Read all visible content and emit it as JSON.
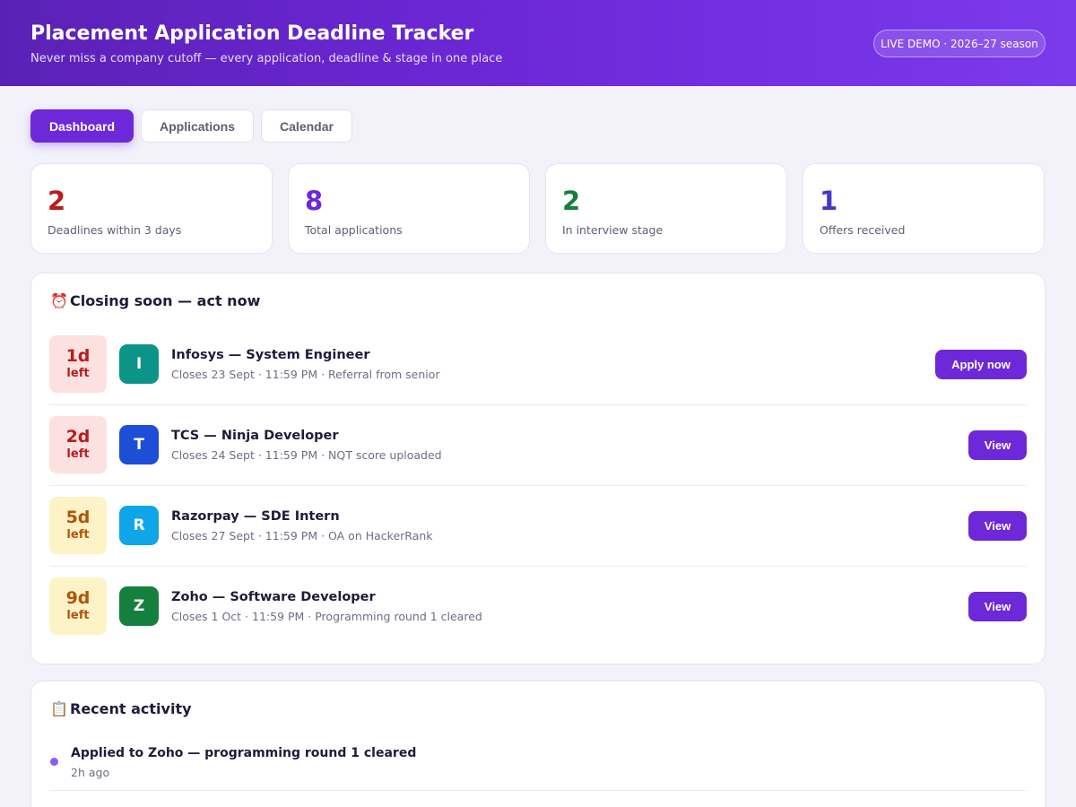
{
  "header": {
    "title": "Placement Application Deadline Tracker",
    "subtitle": "Never miss a company cutoff — every application, deadline & stage in one place",
    "badge": "LIVE DEMO · 2026–27 season"
  },
  "tabs": [
    {
      "label": "Dashboard",
      "active": true
    },
    {
      "label": "Applications",
      "active": false
    },
    {
      "label": "Calendar",
      "active": false
    }
  ],
  "stats": [
    {
      "value": "2",
      "label": "Deadlines within 3 days",
      "color": "#b91c1c"
    },
    {
      "value": "8",
      "label": "Total applications",
      "color": "#6d28d9"
    },
    {
      "value": "2",
      "label": "In interview stage",
      "color": "#15803d"
    },
    {
      "value": "1",
      "label": "Offers received",
      "color": "#4338ca"
    }
  ],
  "closing": {
    "icon": "alarm-clock-icon",
    "emoji": "⏰",
    "title": "Closing soon — act now",
    "items": [
      {
        "days": "1d",
        "left": "left",
        "urgency": "red",
        "initial": "I",
        "avatar_color": "#0d9488",
        "title": "Infosys — System Engineer",
        "meta": "Closes 23 Sept · 11:59 PM · Referral from senior",
        "action": "Apply now"
      },
      {
        "days": "2d",
        "left": "left",
        "urgency": "red",
        "initial": "T",
        "avatar_color": "#1d4ed8",
        "title": "TCS — Ninja Developer",
        "meta": "Closes 24 Sept · 11:59 PM · NQT score uploaded",
        "action": "View"
      },
      {
        "days": "5d",
        "left": "left",
        "urgency": "amber",
        "initial": "R",
        "avatar_color": "#0ea5e9",
        "title": "Razorpay — SDE Intern",
        "meta": "Closes 27 Sept · 11:59 PM · OA on HackerRank",
        "action": "View"
      },
      {
        "days": "9d",
        "left": "left",
        "urgency": "amber",
        "initial": "Z",
        "avatar_color": "#15803d",
        "title": "Zoho — Software Developer",
        "meta": "Closes 1 Oct · 11:59 PM · Programming round 1 cleared",
        "action": "View"
      }
    ]
  },
  "activity": {
    "icon": "clipboard-icon",
    "emoji": "📋",
    "title": "Recent activity",
    "items": [
      {
        "text": "Applied to Zoho — programming round 1 cleared",
        "time": "2h ago"
      }
    ]
  }
}
